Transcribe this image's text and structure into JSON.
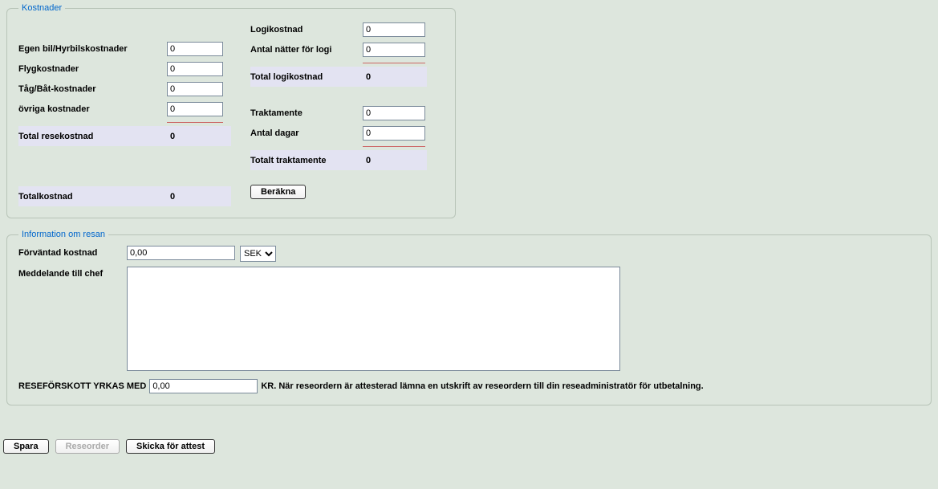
{
  "kostnader": {
    "legend": "Kostnader",
    "egen_bil_label": "Egen bil/Hyrbilskostnader",
    "egen_bil_value": "0",
    "flyg_label": "Flygkostnader",
    "flyg_value": "0",
    "tag_label": "Tåg/Båt-kostnader",
    "tag_value": "0",
    "ovriga_label": "övriga kostnader",
    "ovriga_value": "0",
    "total_rese_label": "Total resekostnad",
    "total_rese_value": "0",
    "totalkostnad_label": "Totalkostnad",
    "totalkostnad_value": "0",
    "logikostnad_label": "Logikostnad",
    "logikostnad_value": "0",
    "antal_natter_label": "Antal nätter för logi",
    "antal_natter_value": "0",
    "total_logi_label": "Total logikostnad",
    "total_logi_value": "0",
    "traktamente_label": "Traktamente",
    "traktamente_value": "0",
    "antal_dagar_label": "Antal dagar",
    "antal_dagar_value": "0",
    "totalt_trakt_label": "Totalt traktamente",
    "totalt_trakt_value": "0",
    "berakna_label": "Beräkna"
  },
  "info": {
    "legend": "Information om resan",
    "forvantad_label": "Förväntad kostnad",
    "forvantad_value": "0,00",
    "currency": "SEK",
    "meddelande_label": "Meddelande till chef",
    "meddelande_value": "",
    "advance_pre": "RESEFÖRSKOTT YRKAS MED",
    "advance_value": "0,00",
    "advance_post": "KR. När reseordern är attesterad lämna en utskrift av reseordern till din reseadministratör för utbetalning."
  },
  "footer": {
    "spara": "Spara",
    "reseorder": "Reseorder",
    "skicka": "Skicka för attest"
  }
}
